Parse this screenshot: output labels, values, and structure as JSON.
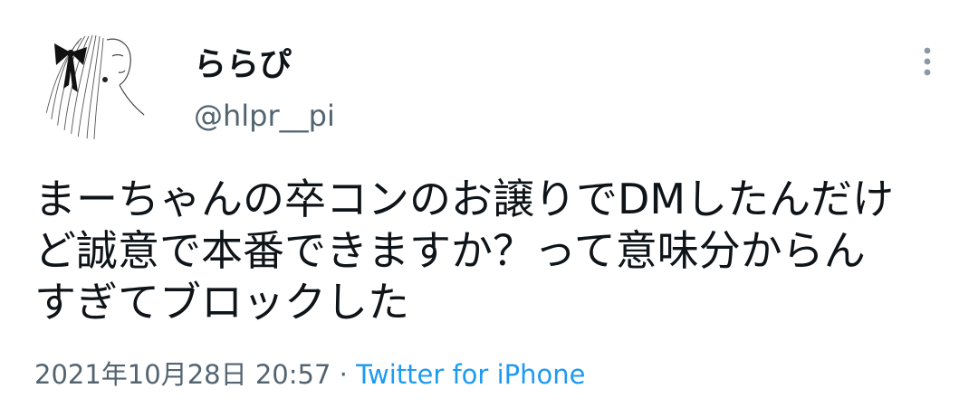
{
  "tweet": {
    "author": {
      "display_name": "ららぴ",
      "handle": "@hlpr__pi"
    },
    "text_lines": [
      "まーちゃんの卒コンのお譲りでDMしたんだけ",
      "ど誠意で本番できますか？って意味分からん",
      "すぎてブロックした"
    ],
    "timestamp": "2021年10月28日 20:57",
    "separator": " · ",
    "source": "Twitter for iPhone"
  },
  "icons": {
    "more": "more-vertical-icon",
    "avatar": "avatar-sketch-girl-with-ribbon"
  },
  "colors": {
    "text": "#0f1419",
    "secondary": "#536471",
    "link": "#1d9bf0",
    "more_icon": "#8b98a5"
  }
}
